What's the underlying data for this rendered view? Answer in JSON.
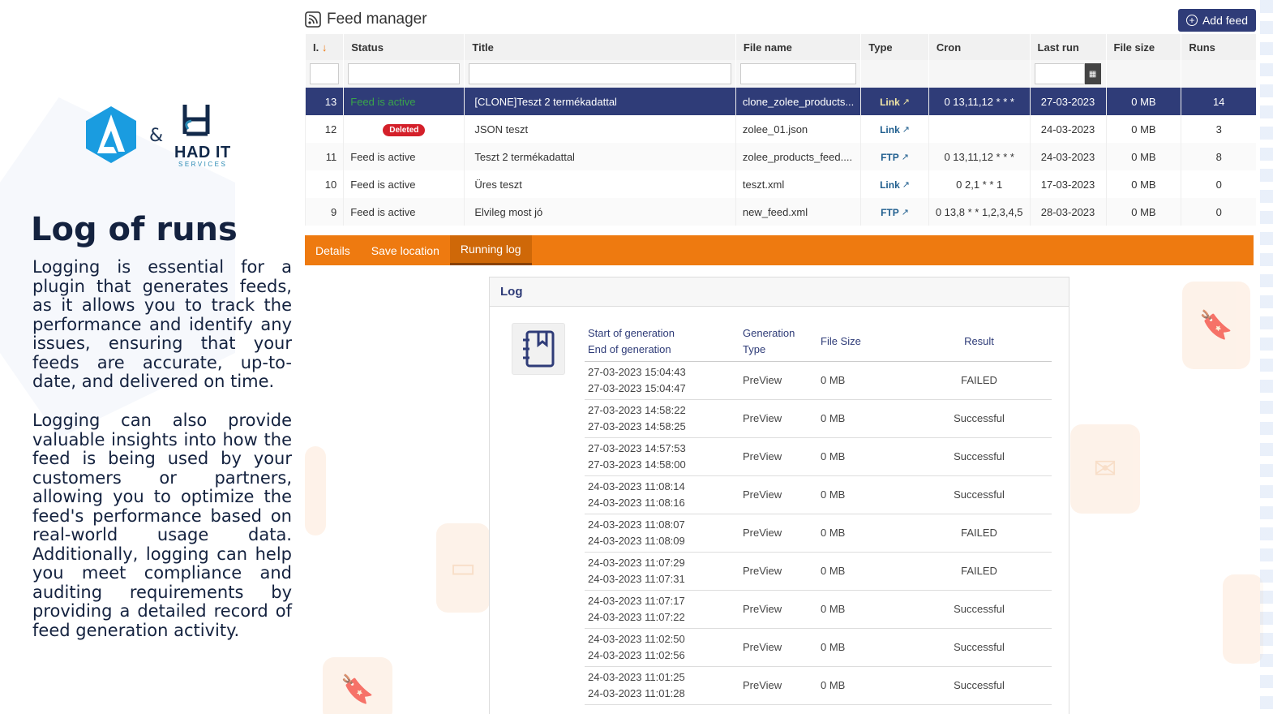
{
  "left": {
    "amp": "&",
    "brand_name": "HAD IT",
    "brand_sub": "SERVICES",
    "title": "Log of runs",
    "para1": "Logging is essential for a plugin that generates feeds, as it allows you to track the performance and identify any issues, ensuring that your feeds are accurate, up-to-date, and delivered on time.",
    "para2": "Logging can also provide valuable insights into how the feed is being used by your customers or partners, allowing you to optimize the feed's performance based on real-world usage data. Additionally, logging can help you meet compliance and auditing requirements by providing a detailed record of feed generation activity."
  },
  "feed_manager": {
    "title": "Feed manager",
    "add_feed_label": "Add feed",
    "columns": [
      "I.",
      "Status",
      "Title",
      "File name",
      "Type",
      "Cron",
      "Last run",
      "File size",
      "Runs"
    ],
    "sort_arrow": "↓",
    "rows": [
      {
        "id": "13",
        "status": "Feed is active",
        "title": "[CLONE]Teszt 2 termékadattal",
        "file": "clone_zolee_products...",
        "type": "Link",
        "cron": "0 13,11,12 * * *",
        "last_run": "27-03-2023",
        "size": "0 MB",
        "runs": "14"
      },
      {
        "id": "12",
        "status": "Deleted",
        "title": "JSON teszt",
        "file": "zolee_01.json",
        "type": "Link",
        "cron": "",
        "last_run": "24-03-2023",
        "size": "0 MB",
        "runs": "3"
      },
      {
        "id": "11",
        "status": "Feed is active",
        "title": "Teszt 2 termékadattal",
        "file": "zolee_products_feed....",
        "type": "FTP",
        "cron": "0 13,11,12 * * *",
        "last_run": "24-03-2023",
        "size": "0 MB",
        "runs": "8"
      },
      {
        "id": "10",
        "status": "Feed is active",
        "title": "Üres teszt",
        "file": "teszt.xml",
        "type": "Link",
        "cron": "0 2,1 * * 1",
        "last_run": "17-03-2023",
        "size": "0 MB",
        "runs": "0"
      },
      {
        "id": "9",
        "status": "Feed is active",
        "title": "Elvileg most jó",
        "file": "new_feed.xml",
        "type": "FTP",
        "cron": "0 13,8 * * 1,2,3,4,5",
        "last_run": "28-03-2023",
        "size": "0 MB",
        "runs": "0"
      }
    ]
  },
  "tabs": [
    "Details",
    "Save location",
    "Running log"
  ],
  "log": {
    "title": "Log",
    "col_start": "Start of generation",
    "col_end": "End of generation",
    "col_type_1": "Generation",
    "col_type_2": "Type",
    "col_size": "File Size",
    "col_result": "Result",
    "entries": [
      {
        "start": "27-03-2023 15:04:43",
        "end": "27-03-2023 15:04:47",
        "type": "PreView",
        "size": "0 MB",
        "result": "FAILED"
      },
      {
        "start": "27-03-2023 14:58:22",
        "end": "27-03-2023 14:58:25",
        "type": "PreView",
        "size": "0 MB",
        "result": "Successful"
      },
      {
        "start": "27-03-2023 14:57:53",
        "end": "27-03-2023 14:58:00",
        "type": "PreView",
        "size": "0 MB",
        "result": "Successful"
      },
      {
        "start": "24-03-2023 11:08:14",
        "end": "24-03-2023 11:08:16",
        "type": "PreView",
        "size": "0 MB",
        "result": "Successful"
      },
      {
        "start": "24-03-2023 11:08:07",
        "end": "24-03-2023 11:08:09",
        "type": "PreView",
        "size": "0 MB",
        "result": "FAILED"
      },
      {
        "start": "24-03-2023 11:07:29",
        "end": "24-03-2023 11:07:31",
        "type": "PreView",
        "size": "0 MB",
        "result": "FAILED"
      },
      {
        "start": "24-03-2023 11:07:17",
        "end": "24-03-2023 11:07:22",
        "type": "PreView",
        "size": "0 MB",
        "result": "Successful"
      },
      {
        "start": "24-03-2023 11:02:50",
        "end": "24-03-2023 11:02:56",
        "type": "PreView",
        "size": "0 MB",
        "result": "Successful"
      },
      {
        "start": "24-03-2023 11:01:25",
        "end": "24-03-2023 11:01:28",
        "type": "PreView",
        "size": "0 MB",
        "result": "Successful"
      }
    ]
  },
  "colors": {
    "navy": "#2f3c78",
    "orange": "#ee7a10",
    "active_green": "#2f9b34",
    "failed_red": "#e02020",
    "success_green": "#28a745",
    "deleted_badge": "#d4202a"
  },
  "icons": [
    "rss-icon",
    "plus-circle-icon",
    "sort-arrow-icon",
    "calendar-icon",
    "external-link-icon",
    "logbook-icon"
  ]
}
